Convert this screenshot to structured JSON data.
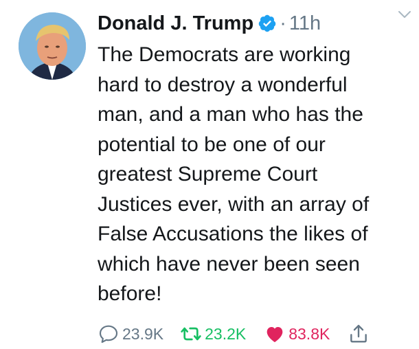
{
  "author": {
    "name": "Donald J. Trump",
    "verified_icon": "verified-badge-icon",
    "separator": "·",
    "time": "11h"
  },
  "tweet": {
    "lines": [
      "The Democrats are working",
      "hard to destroy a wonderful",
      "man, and a man who has the",
      "potential to be one of our",
      "greatest Supreme Court",
      "Justices ever, with an array of",
      "False Accusations the likes of",
      "which have never been seen",
      "before!"
    ]
  },
  "actions": {
    "replies": "23.9K",
    "retweets": "23.2K",
    "likes": "83.8K"
  },
  "colors": {
    "verified": "#1da1f2",
    "retweet": "#17bf63",
    "like": "#e0245e",
    "muted": "#657786"
  }
}
